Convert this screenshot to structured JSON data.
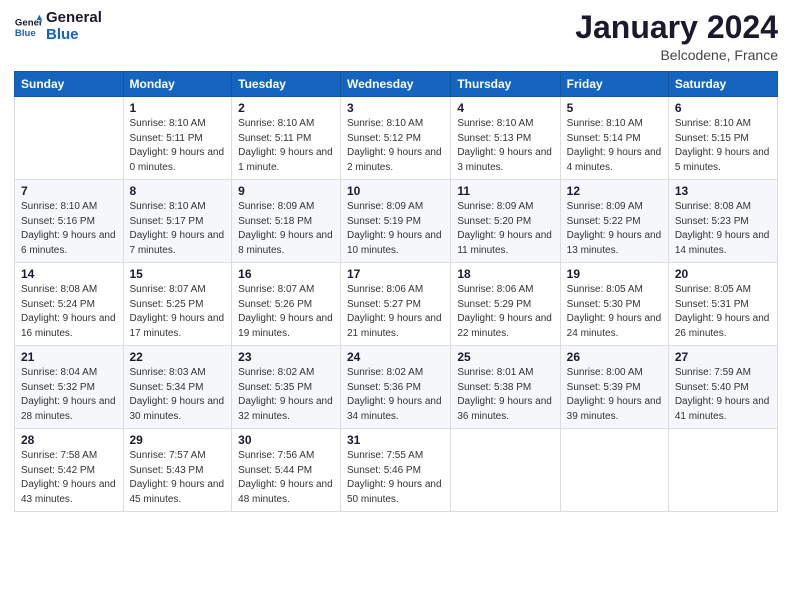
{
  "logo": {
    "line1": "General",
    "line2": "Blue"
  },
  "title": "January 2024",
  "location": "Belcodene, France",
  "header_days": [
    "Sunday",
    "Monday",
    "Tuesday",
    "Wednesday",
    "Thursday",
    "Friday",
    "Saturday"
  ],
  "weeks": [
    [
      {
        "day": "",
        "sunrise": "",
        "sunset": "",
        "daylight": ""
      },
      {
        "day": "1",
        "sunrise": "Sunrise: 8:10 AM",
        "sunset": "Sunset: 5:11 PM",
        "daylight": "Daylight: 9 hours and 0 minutes."
      },
      {
        "day": "2",
        "sunrise": "Sunrise: 8:10 AM",
        "sunset": "Sunset: 5:11 PM",
        "daylight": "Daylight: 9 hours and 1 minute."
      },
      {
        "day": "3",
        "sunrise": "Sunrise: 8:10 AM",
        "sunset": "Sunset: 5:12 PM",
        "daylight": "Daylight: 9 hours and 2 minutes."
      },
      {
        "day": "4",
        "sunrise": "Sunrise: 8:10 AM",
        "sunset": "Sunset: 5:13 PM",
        "daylight": "Daylight: 9 hours and 3 minutes."
      },
      {
        "day": "5",
        "sunrise": "Sunrise: 8:10 AM",
        "sunset": "Sunset: 5:14 PM",
        "daylight": "Daylight: 9 hours and 4 minutes."
      },
      {
        "day": "6",
        "sunrise": "Sunrise: 8:10 AM",
        "sunset": "Sunset: 5:15 PM",
        "daylight": "Daylight: 9 hours and 5 minutes."
      }
    ],
    [
      {
        "day": "7",
        "sunrise": "Sunrise: 8:10 AM",
        "sunset": "Sunset: 5:16 PM",
        "daylight": "Daylight: 9 hours and 6 minutes."
      },
      {
        "day": "8",
        "sunrise": "Sunrise: 8:10 AM",
        "sunset": "Sunset: 5:17 PM",
        "daylight": "Daylight: 9 hours and 7 minutes."
      },
      {
        "day": "9",
        "sunrise": "Sunrise: 8:09 AM",
        "sunset": "Sunset: 5:18 PM",
        "daylight": "Daylight: 9 hours and 8 minutes."
      },
      {
        "day": "10",
        "sunrise": "Sunrise: 8:09 AM",
        "sunset": "Sunset: 5:19 PM",
        "daylight": "Daylight: 9 hours and 10 minutes."
      },
      {
        "day": "11",
        "sunrise": "Sunrise: 8:09 AM",
        "sunset": "Sunset: 5:20 PM",
        "daylight": "Daylight: 9 hours and 11 minutes."
      },
      {
        "day": "12",
        "sunrise": "Sunrise: 8:09 AM",
        "sunset": "Sunset: 5:22 PM",
        "daylight": "Daylight: 9 hours and 13 minutes."
      },
      {
        "day": "13",
        "sunrise": "Sunrise: 8:08 AM",
        "sunset": "Sunset: 5:23 PM",
        "daylight": "Daylight: 9 hours and 14 minutes."
      }
    ],
    [
      {
        "day": "14",
        "sunrise": "Sunrise: 8:08 AM",
        "sunset": "Sunset: 5:24 PM",
        "daylight": "Daylight: 9 hours and 16 minutes."
      },
      {
        "day": "15",
        "sunrise": "Sunrise: 8:07 AM",
        "sunset": "Sunset: 5:25 PM",
        "daylight": "Daylight: 9 hours and 17 minutes."
      },
      {
        "day": "16",
        "sunrise": "Sunrise: 8:07 AM",
        "sunset": "Sunset: 5:26 PM",
        "daylight": "Daylight: 9 hours and 19 minutes."
      },
      {
        "day": "17",
        "sunrise": "Sunrise: 8:06 AM",
        "sunset": "Sunset: 5:27 PM",
        "daylight": "Daylight: 9 hours and 21 minutes."
      },
      {
        "day": "18",
        "sunrise": "Sunrise: 8:06 AM",
        "sunset": "Sunset: 5:29 PM",
        "daylight": "Daylight: 9 hours and 22 minutes."
      },
      {
        "day": "19",
        "sunrise": "Sunrise: 8:05 AM",
        "sunset": "Sunset: 5:30 PM",
        "daylight": "Daylight: 9 hours and 24 minutes."
      },
      {
        "day": "20",
        "sunrise": "Sunrise: 8:05 AM",
        "sunset": "Sunset: 5:31 PM",
        "daylight": "Daylight: 9 hours and 26 minutes."
      }
    ],
    [
      {
        "day": "21",
        "sunrise": "Sunrise: 8:04 AM",
        "sunset": "Sunset: 5:32 PM",
        "daylight": "Daylight: 9 hours and 28 minutes."
      },
      {
        "day": "22",
        "sunrise": "Sunrise: 8:03 AM",
        "sunset": "Sunset: 5:34 PM",
        "daylight": "Daylight: 9 hours and 30 minutes."
      },
      {
        "day": "23",
        "sunrise": "Sunrise: 8:02 AM",
        "sunset": "Sunset: 5:35 PM",
        "daylight": "Daylight: 9 hours and 32 minutes."
      },
      {
        "day": "24",
        "sunrise": "Sunrise: 8:02 AM",
        "sunset": "Sunset: 5:36 PM",
        "daylight": "Daylight: 9 hours and 34 minutes."
      },
      {
        "day": "25",
        "sunrise": "Sunrise: 8:01 AM",
        "sunset": "Sunset: 5:38 PM",
        "daylight": "Daylight: 9 hours and 36 minutes."
      },
      {
        "day": "26",
        "sunrise": "Sunrise: 8:00 AM",
        "sunset": "Sunset: 5:39 PM",
        "daylight": "Daylight: 9 hours and 39 minutes."
      },
      {
        "day": "27",
        "sunrise": "Sunrise: 7:59 AM",
        "sunset": "Sunset: 5:40 PM",
        "daylight": "Daylight: 9 hours and 41 minutes."
      }
    ],
    [
      {
        "day": "28",
        "sunrise": "Sunrise: 7:58 AM",
        "sunset": "Sunset: 5:42 PM",
        "daylight": "Daylight: 9 hours and 43 minutes."
      },
      {
        "day": "29",
        "sunrise": "Sunrise: 7:57 AM",
        "sunset": "Sunset: 5:43 PM",
        "daylight": "Daylight: 9 hours and 45 minutes."
      },
      {
        "day": "30",
        "sunrise": "Sunrise: 7:56 AM",
        "sunset": "Sunset: 5:44 PM",
        "daylight": "Daylight: 9 hours and 48 minutes."
      },
      {
        "day": "31",
        "sunrise": "Sunrise: 7:55 AM",
        "sunset": "Sunset: 5:46 PM",
        "daylight": "Daylight: 9 hours and 50 minutes."
      },
      {
        "day": "",
        "sunrise": "",
        "sunset": "",
        "daylight": ""
      },
      {
        "day": "",
        "sunrise": "",
        "sunset": "",
        "daylight": ""
      },
      {
        "day": "",
        "sunrise": "",
        "sunset": "",
        "daylight": ""
      }
    ]
  ]
}
